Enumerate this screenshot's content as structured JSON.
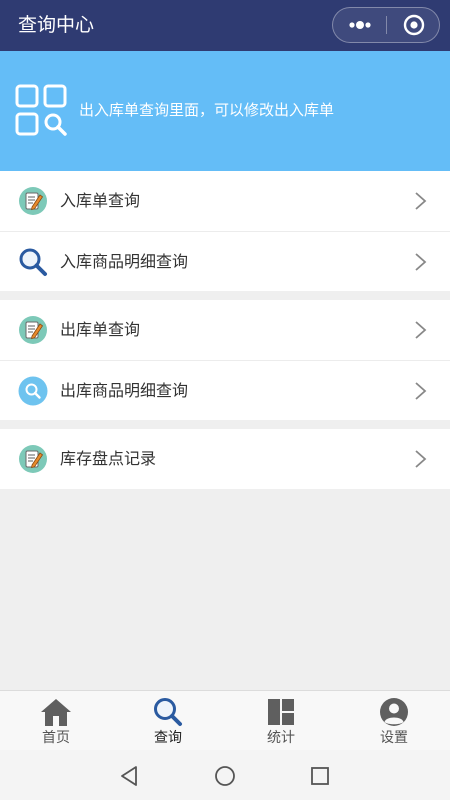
{
  "header": {
    "title": "查询中心",
    "capsule_icons": [
      "more-icon",
      "close-target-icon"
    ]
  },
  "banner": {
    "text": "出入库单查询里面，可以修改出入库单",
    "icon": "grid-search-icon"
  },
  "groups": [
    {
      "items": [
        {
          "label": "入库单查询",
          "icon": "edit-note-icon"
        },
        {
          "label": "入库商品明细查询",
          "icon": "search-icon"
        }
      ]
    },
    {
      "items": [
        {
          "label": "出库单查询",
          "icon": "edit-note-icon"
        },
        {
          "label": "出库商品明细查询",
          "icon": "search-circle-icon"
        }
      ]
    },
    {
      "items": [
        {
          "label": "库存盘点记录",
          "icon": "edit-note-icon"
        }
      ]
    }
  ],
  "tabbar": {
    "active": "查询",
    "tabs": [
      {
        "label": "首页",
        "icon": "home-icon"
      },
      {
        "label": "查询",
        "icon": "search-icon"
      },
      {
        "label": "统计",
        "icon": "stats-grid-icon"
      },
      {
        "label": "设置",
        "icon": "user-icon"
      }
    ]
  },
  "system_nav": [
    "back-icon",
    "home-circle-icon",
    "recents-square-icon"
  ],
  "colors": {
    "header_bg": "#2f3b72",
    "banner_bg": "#64bdf7",
    "page_bg": "#efefef",
    "search_blue": "#2a5aa0",
    "accent_teal": "#7dc9b8"
  }
}
